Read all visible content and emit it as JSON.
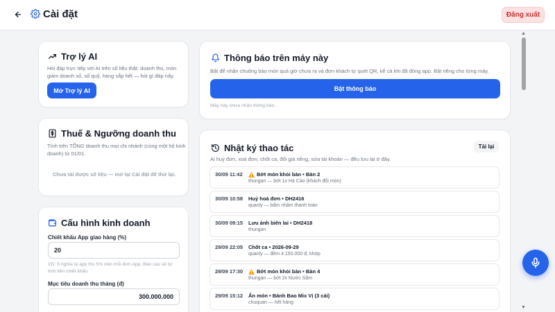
{
  "header": {
    "title": "Cài đặt",
    "logout_label": "Đăng xuất"
  },
  "ai_card": {
    "title": "Trợ lý AI",
    "description": "Hỏi đáp trực tiếp với AI trên số liệu thật: doanh thu, món giảm doanh số, sổ quỹ, hàng sắp hết — hỏi gì đáp nấy.",
    "button_label": "Mở Trợ lý AI"
  },
  "tax_card": {
    "title": "Thuế & Ngưỡng doanh thu",
    "description": "Tính trên TỔNG doanh thu mọi chi nhánh (cùng một hộ kinh doanh) từ 01/01.",
    "empty_message": "Chưa tải được số liệu — mở lại Cài đặt để thử lại."
  },
  "business_card": {
    "title": "Cấu hình kinh doanh",
    "commission_label": "Chiết khấu App giao hàng (%)",
    "commission_value": "20",
    "commission_hint": "VD: 5 nghĩa là app thu 5% trên mỗi đơn App. Báo cáo sẽ tự tính tiền chiết khấu.",
    "target_label": "Mục tiêu doanh thu tháng (đ)",
    "target_value": "300.000.000"
  },
  "notify_card": {
    "title": "Thông báo trên máy này",
    "description": "Bật để nhận chuông báo món quá giờ chưa ra và đơn khách tự quét QR, kể cả khi đã đóng app. Bật riêng cho từng máy.",
    "button_label": "Bật thông báo",
    "status": "Máy này chưa nhận thông báo."
  },
  "log_card": {
    "title": "Nhật ký thao tác",
    "description": "Ai huỷ đơn, xoá đơn, chốt ca, đổi giá riêng, sửa tài khoản — đều lưu lại ở đây.",
    "reload_label": "Tải lại",
    "items": [
      {
        "time": "30/09 11:42",
        "warn": true,
        "title": "Bớt món khỏi bàn • Bàn 2",
        "sub": "thungan — bớt 1x Hà Cảo (khách đổi món)"
      },
      {
        "time": "30/09 10:58",
        "warn": false,
        "title": "Huỷ hoá đơn • DH2416",
        "sub": "quanly — bấm nhầm thanh toán"
      },
      {
        "time": "30/09 09:15",
        "warn": false,
        "title": "Lưu ảnh biên lai • DH2418",
        "sub": "thungan"
      },
      {
        "time": "29/09 22:05",
        "warn": false,
        "title": "Chốt ca • 2026-09-29",
        "sub": "quanly — đếm 4.150.000 đ, khớp"
      },
      {
        "time": "29/09 17:30",
        "warn": true,
        "title": "Bớt món khỏi bàn • Bàn 4",
        "sub": "thungan — bớt 2x Nước Sâm"
      },
      {
        "time": "29/09 15:12",
        "warn": false,
        "title": "Ẩn món • Bánh Bao Mix Vị (3 cái)",
        "sub": "chuquan — hết hàng"
      }
    ]
  },
  "colors": {
    "primary": "#2563eb",
    "logout_bg": "#fde2e2",
    "logout_text": "#c53030",
    "page_bg": "#f3f4f6"
  }
}
